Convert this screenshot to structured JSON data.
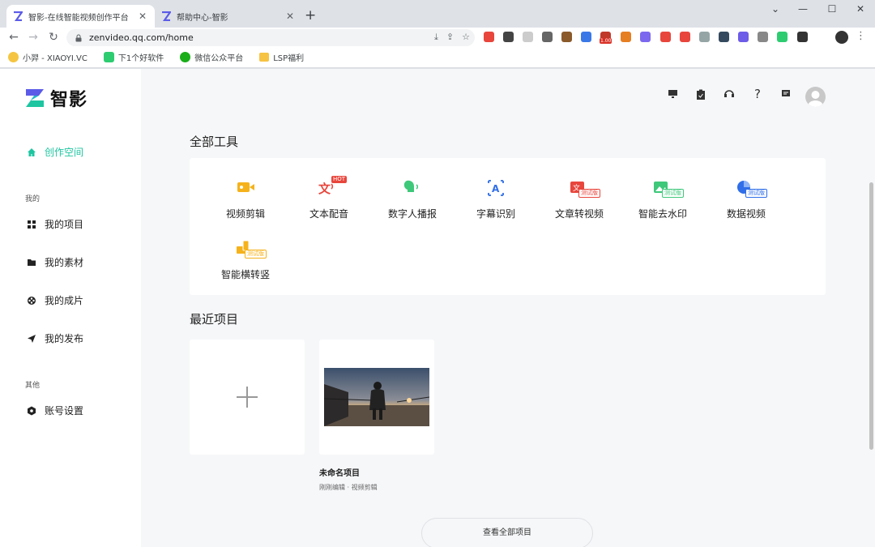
{
  "browser": {
    "tabs": [
      {
        "title": "智影-在线智能视频创作平台",
        "active": true
      },
      {
        "title": "帮助中心-智影",
        "active": false
      }
    ],
    "url": "zenvideo.qq.com/home",
    "bookmarks": [
      "小羿 - XIAOYI.VC",
      "下1个好软件",
      "微信公众平台",
      "LSP福利"
    ],
    "extensions": [
      "extension-1",
      "extension-2",
      "extension-3",
      "extension-4",
      "extension-5",
      "extension-6",
      "extension-7",
      "extension-8",
      "extension-9",
      "extension-10",
      "extension-11",
      "extension-12",
      "extension-13",
      "extension-14",
      "extension-15",
      "extension-16",
      "extension-17"
    ],
    "ext_badge": "1.00"
  },
  "app": {
    "logo_text": "智影",
    "sidebar": {
      "active_item": "创作空间",
      "section_mine": "我的",
      "items_mine": [
        "我的项目",
        "我的素材",
        "我的成片",
        "我的发布"
      ],
      "section_other": "其他",
      "items_other": [
        "账号设置"
      ]
    },
    "tools_title": "全部工具",
    "tools": [
      {
        "label": "视频剪辑",
        "icon": "video-edit-icon",
        "badge": ""
      },
      {
        "label": "文本配音",
        "icon": "text-voice-icon",
        "badge": "HOT"
      },
      {
        "label": "数字人播报",
        "icon": "digital-human-icon",
        "badge": ""
      },
      {
        "label": "字幕识别",
        "icon": "subtitle-recognition-icon",
        "badge": ""
      },
      {
        "label": "文章转视频",
        "icon": "article-to-video-icon",
        "badge": "测试版"
      },
      {
        "label": "智能去水印",
        "icon": "remove-watermark-icon",
        "badge": "测试版"
      },
      {
        "label": "数据视频",
        "icon": "data-video-icon",
        "badge": "测试版"
      },
      {
        "label": "智能横转竖",
        "icon": "landscape-to-portrait-icon",
        "badge": "测试版"
      }
    ],
    "recent_title": "最近项目",
    "project": {
      "name": "未命名项目",
      "meta": "刚刚编辑 · 视频剪辑"
    },
    "view_all": "查看全部项目",
    "accent": "#1ec5a0"
  }
}
